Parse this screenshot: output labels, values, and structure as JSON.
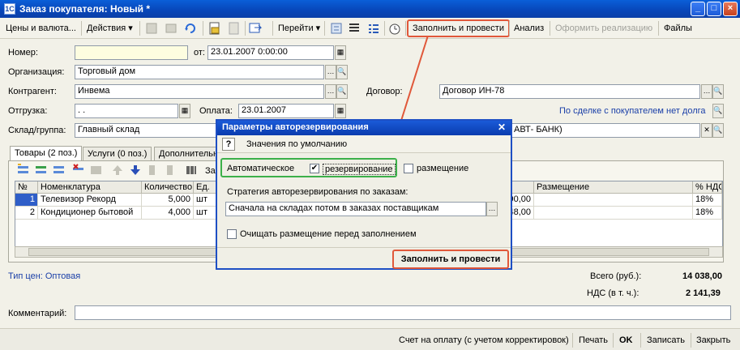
{
  "window": {
    "title": "Заказ покупателя: Новый *",
    "min": "_",
    "max": "□",
    "close": "×"
  },
  "toolbar": {
    "prices": "Цены и валюта...",
    "actions": "Действия ▾",
    "goto": "Перейти ▾",
    "fill_post": "Заполнить и провести",
    "analysis": "Анализ",
    "make_sale": "Оформить реализацию",
    "files": "Файлы"
  },
  "form": {
    "number_label": "Номер:",
    "number_value": "",
    "from_label": "от:",
    "date_value": "23.01.2007  0:00:00",
    "org_label": "Организация:",
    "org_value": "Торговый дом",
    "contractor_label": "Контрагент:",
    "contractor_value": "Инвема",
    "contract_label": "Договор:",
    "contract_value": "Договор ИН-78",
    "shipment_label": "Отгрузка:",
    "shipment_value": ". .",
    "payment_label": "Оплата:",
    "payment_value": "23.01.2007",
    "debt_link": "По сделке с покупателем нет долга",
    "warehouse_label": "Склад/группа:",
    "warehouse_value": "Главный склад",
    "bank_value": "АВТ- БАНК)"
  },
  "tabs": [
    {
      "label": "Товары (2 поз.)"
    },
    {
      "label": "Услуги (0 поз.)"
    },
    {
      "label": "Дополнительн"
    }
  ],
  "tab_tool": {
    "pick": "За"
  },
  "table": {
    "headers": [
      "№",
      "Номенклатура",
      "Количество",
      "Ед.",
      "Размещение",
      "% НДС"
    ],
    "rows": [
      {
        "n": "1",
        "name": "Телевизор Рекорд",
        "qty": "5,000",
        "unit": "шт",
        "sum": "90,00",
        "vat": "18%"
      },
      {
        "n": "2",
        "name": "Кондиционер бытовой",
        "qty": "4,000",
        "unit": "шт",
        "sum": "48,00",
        "vat": "18%"
      }
    ]
  },
  "totals": {
    "price_type": "Тип цен: Оптовая",
    "total_label": "Всего (руб.):",
    "total_value": "14 038,00",
    "vat_label": "НДС (в т. ч.):",
    "vat_value": "2 141,39"
  },
  "comment": {
    "label": "Комментарий:",
    "value": ""
  },
  "statusbar": {
    "invoice": "Счет на оплату (с учетом корректировок)",
    "print": "Печать",
    "ok": "OK",
    "save": "Записать",
    "close": "Закрыть"
  },
  "dialog": {
    "title": "Параметры авторезервирования",
    "close": "✕",
    "help": "?",
    "defaults": "Значения по умолчанию",
    "auto_label": "Автоматическое",
    "reserve_label": "резервирование",
    "place_label": "размещение",
    "strategy_label": "Стратегия авторезервирования по заказам:",
    "strategy_value": "Сначала на складах потом в заказах поставщикам",
    "clear_label": "Очищать размещение перед заполнением",
    "fill_post": "Заполнить и провести",
    "reserve_checked": "✔"
  },
  "colors": {
    "highlight_red": "#e0583a",
    "highlight_green": "#3cb04a",
    "title_blue": "#0a4fc8"
  }
}
